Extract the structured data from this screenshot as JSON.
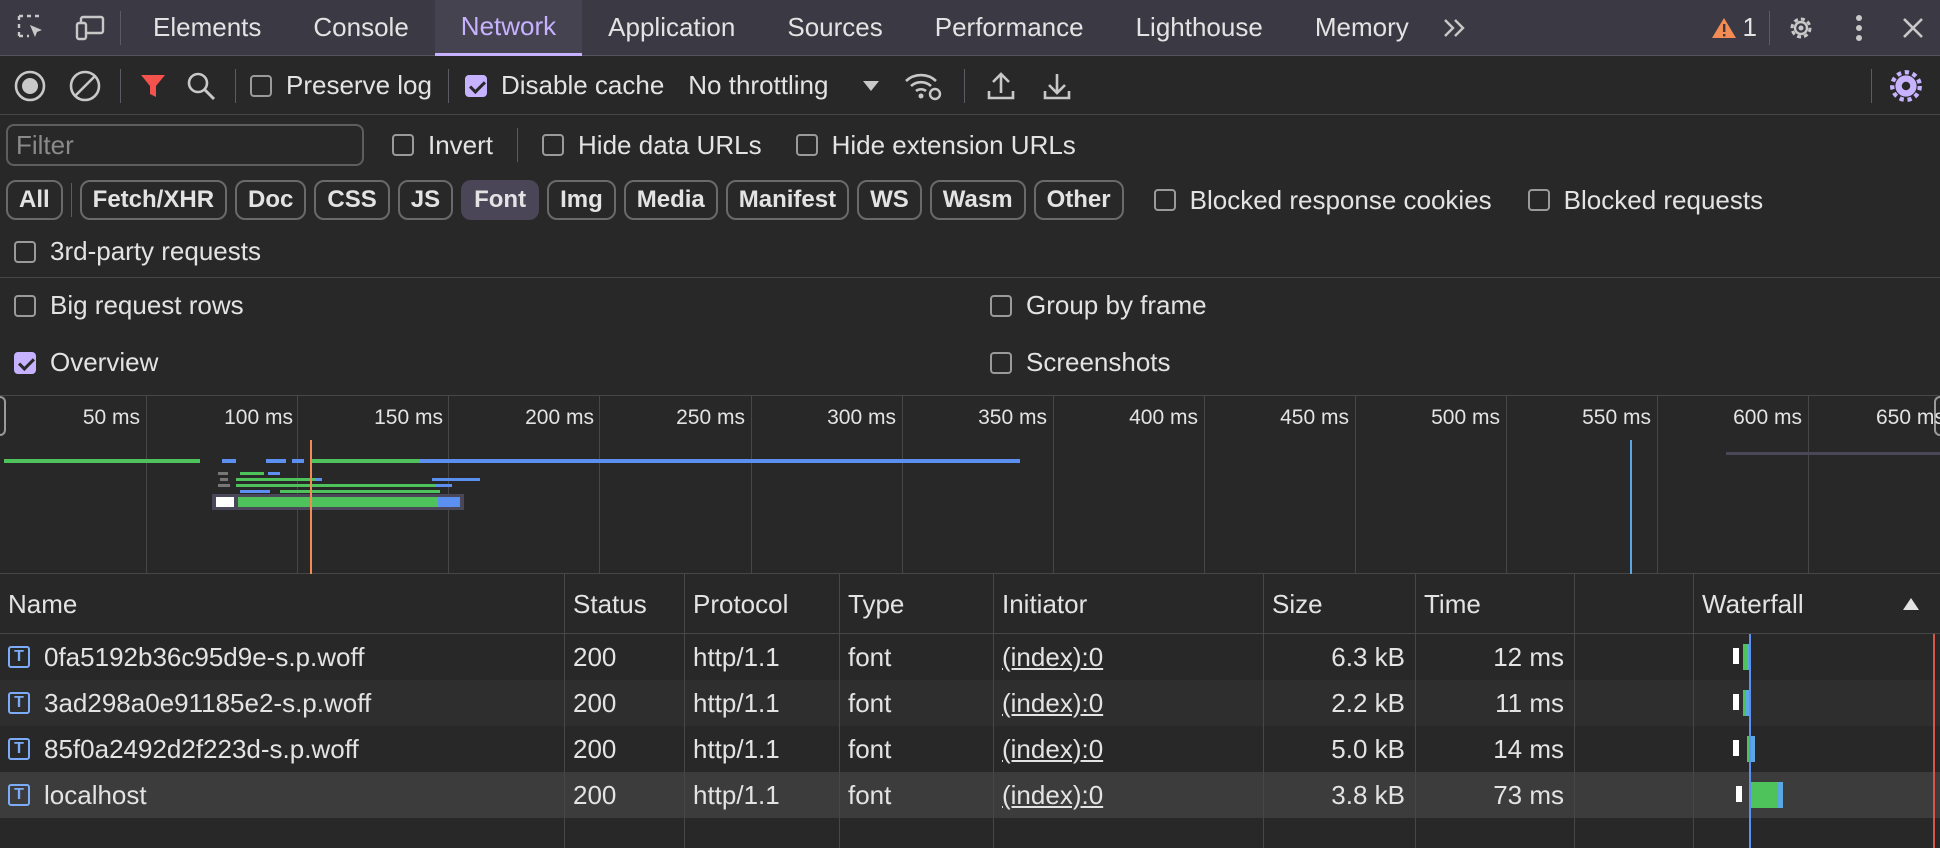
{
  "tabs": [
    "Elements",
    "Console",
    "Network",
    "Application",
    "Sources",
    "Performance",
    "Lighthouse",
    "Memory"
  ],
  "active_tab": "Network",
  "warnings": {
    "count": "1"
  },
  "toolbar": {
    "preserve_log": "Preserve log",
    "disable_cache": "Disable cache",
    "throttling": "No throttling"
  },
  "filter": {
    "placeholder": "Filter",
    "invert": "Invert",
    "hide_data_urls": "Hide data URLs",
    "hide_extension_urls": "Hide extension URLs"
  },
  "type_filters": [
    "All",
    "Fetch/XHR",
    "Doc",
    "CSS",
    "JS",
    "Font",
    "Img",
    "Media",
    "Manifest",
    "WS",
    "Wasm",
    "Other"
  ],
  "active_type": "Font",
  "extra_filters": {
    "blocked_cookies": "Blocked response cookies",
    "blocked_requests": "Blocked requests",
    "third_party": "3rd-party requests"
  },
  "settings": {
    "big_rows": "Big request rows",
    "group_by_frame": "Group by frame",
    "overview": "Overview",
    "screenshots": "Screenshots"
  },
  "overview": {
    "tick_labels": [
      "50 ms",
      "100 ms",
      "150 ms",
      "200 ms",
      "250 ms",
      "300 ms",
      "350 ms",
      "400 ms",
      "450 ms",
      "500 ms",
      "550 ms",
      "600 ms",
      "650 ms"
    ]
  },
  "table": {
    "columns": {
      "name": "Name",
      "status": "Status",
      "protocol": "Protocol",
      "type": "Type",
      "initiator": "Initiator",
      "size": "Size",
      "time": "Time",
      "waterfall": "Waterfall"
    },
    "rows": [
      {
        "name": "0fa5192b36c95d9e-s.p.woff",
        "status": "200",
        "protocol": "http/1.1",
        "type": "font",
        "initiator": "(index):0",
        "size": "6.3 kB",
        "time": "12 ms"
      },
      {
        "name": "3ad298a0e91185e2-s.p.woff",
        "status": "200",
        "protocol": "http/1.1",
        "type": "font",
        "initiator": "(index):0",
        "size": "2.2 kB",
        "time": "11 ms"
      },
      {
        "name": "85f0a2492d2f223d-s.p.woff",
        "status": "200",
        "protocol": "http/1.1",
        "type": "font",
        "initiator": "(index):0",
        "size": "5.0 kB",
        "time": "14 ms"
      },
      {
        "name": "localhost",
        "status": "200",
        "protocol": "http/1.1",
        "type": "font",
        "initiator": "(index):0",
        "size": "3.8 kB",
        "time": "73 ms"
      }
    ]
  },
  "colors": {
    "accent": "#c6b2ff",
    "warning": "#f28b54",
    "waiting": "#4ec35b",
    "download": "#5b8ff0"
  }
}
